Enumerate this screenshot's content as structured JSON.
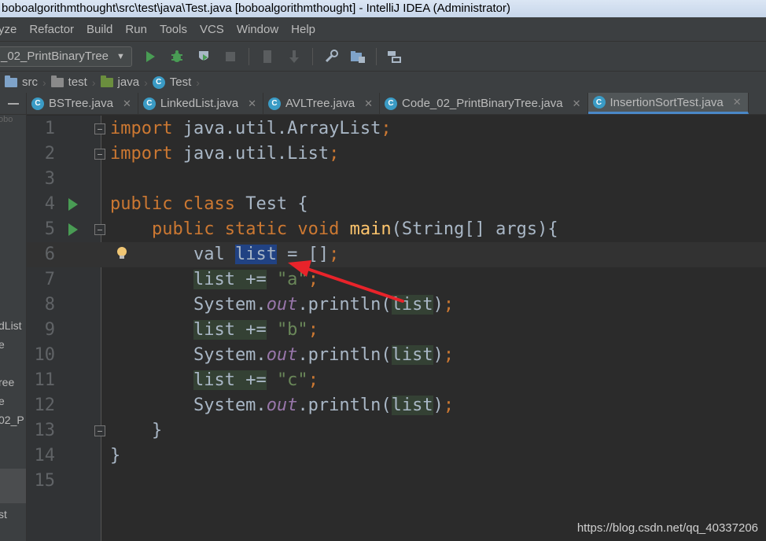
{
  "window": {
    "title": "boboalgorithmthought\\src\\test\\java\\Test.java [boboalgorithmthought] - IntelliJ IDEA (Administrator)"
  },
  "menu": [
    "yze",
    "Refactor",
    "Build",
    "Run",
    "Tools",
    "VCS",
    "Window",
    "Help"
  ],
  "toolbar": {
    "run_config": "_02_PrintBinaryTree",
    "icons": [
      "run-icon",
      "debug-icon",
      "coverage-icon",
      "stop-icon",
      "build-icon",
      "rebuild-icon",
      "settings-wrench-icon",
      "project-structure-icon",
      "structure-icon"
    ]
  },
  "breadcrumb": [
    "src",
    "test",
    "java",
    "Test"
  ],
  "left_panel": {
    "items": [
      "obo",
      "dList",
      "e",
      "ree",
      "e",
      "02_P",
      "st"
    ]
  },
  "tabs": [
    {
      "label": "BSTree.java",
      "active": false
    },
    {
      "label": "LinkedList.java",
      "active": false
    },
    {
      "label": "AVLTree.java",
      "active": false
    },
    {
      "label": "Code_02_PrintBinaryTree.java",
      "active": false
    },
    {
      "label": "InsertionSortTest.java",
      "active": true
    }
  ],
  "editor": {
    "line_numbers": [
      "1",
      "2",
      "3",
      "4",
      "5",
      "6",
      "7",
      "8",
      "9",
      "10",
      "11",
      "12",
      "13",
      "14",
      "15"
    ],
    "lines": [
      "import java.util.ArrayList;",
      "import java.util.List;",
      "",
      "public class Test {",
      "    public static void main(String[] args){",
      "        val list = [];",
      "        list += \"a\";",
      "        System.out.println(list);",
      "        list += \"b\";",
      "        System.out.println(list);",
      "        list += \"c\";",
      "        System.out.println(list);",
      "    }",
      "}",
      ""
    ]
  },
  "colors": {
    "keyword": "#cc7832",
    "method": "#ffc66d",
    "string": "#6a8759",
    "field": "#9876aa",
    "default_text": "#a9b7c6",
    "annotation_arrow": "#e8232a"
  },
  "watermark": "https://blog.csdn.net/qq_40337206"
}
